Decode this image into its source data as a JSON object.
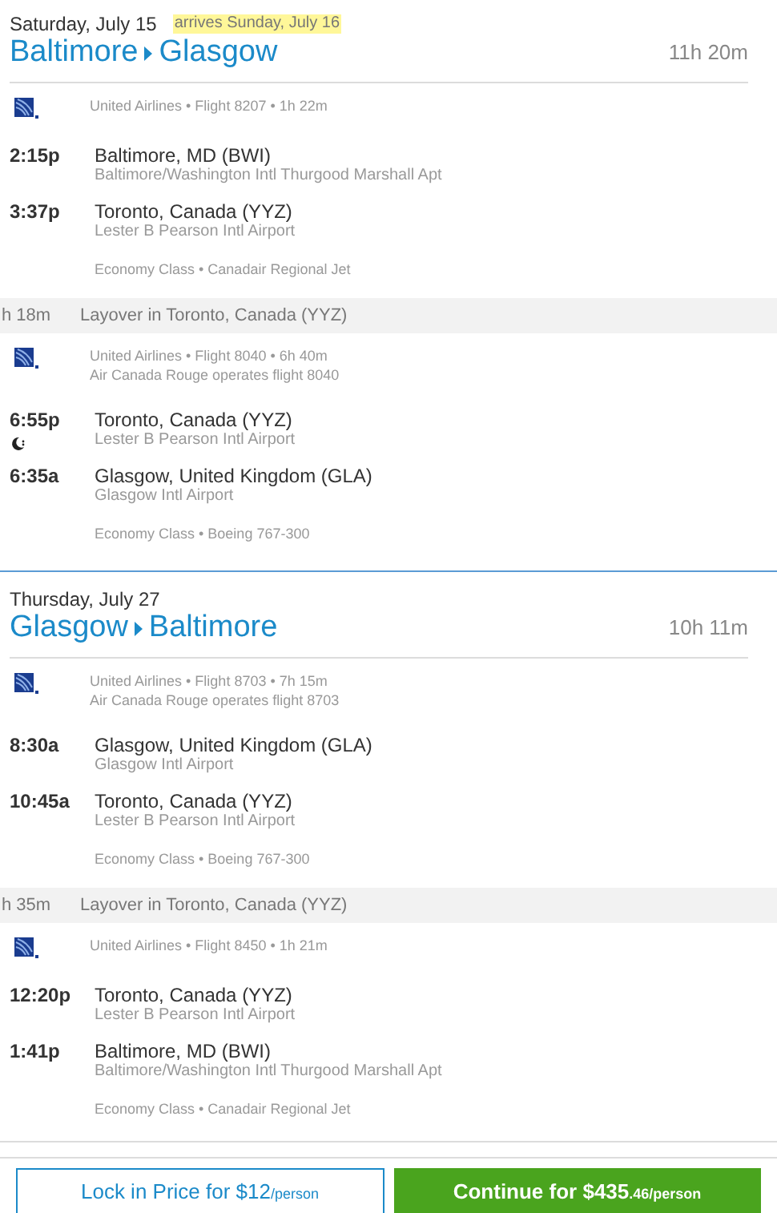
{
  "legs": [
    {
      "date": "Saturday, July 15",
      "arrival_note": "arrives Sunday, July 16",
      "origin": "Baltimore",
      "destination": "Glasgow",
      "duration": "11h 20m",
      "items": [
        {
          "kind": "segment",
          "info": [
            "United Airlines • Flight 8207 • 1h 22m"
          ],
          "stops": [
            {
              "time": "2:15p",
              "city": "Baltimore, MD (BWI)",
              "airport": "Baltimore/Washington Intl Thurgood Marshall Apt",
              "overnight": false
            },
            {
              "time": "3:37p",
              "city": "Toronto, Canada (YYZ)",
              "airport": "Lester B Pearson Intl Airport",
              "overnight": false
            }
          ],
          "cabin": "Economy Class • Canadair Regional Jet"
        },
        {
          "kind": "layover",
          "duration": "h 18m",
          "text": "Layover in Toronto, Canada (YYZ)"
        },
        {
          "kind": "segment",
          "info": [
            "United Airlines • Flight 8040 • 6h 40m",
            "Air Canada Rouge operates flight 8040"
          ],
          "stops": [
            {
              "time": "6:55p",
              "city": "Toronto, Canada (YYZ)",
              "airport": "Lester B Pearson Intl Airport",
              "overnight": true
            },
            {
              "time": "6:35a",
              "city": "Glasgow, United Kingdom (GLA)",
              "airport": "Glasgow Intl Airport",
              "overnight": false
            }
          ],
          "cabin": "Economy Class • Boeing 767-300"
        }
      ]
    },
    {
      "date": "Thursday, July 27",
      "origin": "Glasgow",
      "destination": "Baltimore",
      "duration": "10h 11m",
      "items": [
        {
          "kind": "segment",
          "info": [
            "United Airlines • Flight 8703 • 7h 15m",
            "Air Canada Rouge operates flight 8703"
          ],
          "stops": [
            {
              "time": "8:30a",
              "city": "Glasgow, United Kingdom (GLA)",
              "airport": "Glasgow Intl Airport",
              "overnight": false
            },
            {
              "time": "10:45a",
              "city": "Toronto, Canada (YYZ)",
              "airport": "Lester B Pearson Intl Airport",
              "overnight": false
            }
          ],
          "cabin": "Economy Class • Boeing 767-300"
        },
        {
          "kind": "layover",
          "duration": "h 35m",
          "text": "Layover in Toronto, Canada (YYZ)"
        },
        {
          "kind": "segment",
          "info": [
            "United Airlines • Flight 8450 • 1h 21m"
          ],
          "stops": [
            {
              "time": "12:20p",
              "city": "Toronto, Canada (YYZ)",
              "airport": "Lester B Pearson Intl Airport",
              "overnight": false
            },
            {
              "time": "1:41p",
              "city": "Baltimore, MD (BWI)",
              "airport": "Baltimore/Washington Intl Thurgood Marshall Apt",
              "overnight": false
            }
          ],
          "cabin": "Economy Class • Canadair Regional Jet"
        }
      ]
    }
  ],
  "actions": {
    "lock": {
      "label": "Lock in Price for $12",
      "unit": "/person"
    },
    "continue": {
      "label": "Continue for $435",
      "unit": ".46/person"
    }
  }
}
